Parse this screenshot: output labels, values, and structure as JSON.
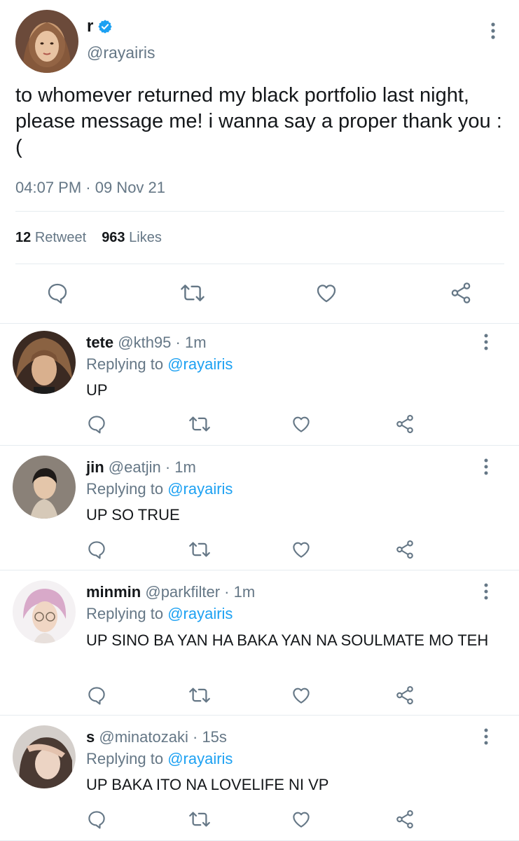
{
  "main_tweet": {
    "display_name": "r",
    "handle": "@rayairis",
    "text": "to whomever returned my black portfolio last night, please message me! i wanna say a proper thank you :(",
    "timestamp": "04:07 PM · 09 Nov 21",
    "retweet_count": "12",
    "retweet_label": "Retweet",
    "like_count": "963",
    "like_label": "Likes"
  },
  "colors": {
    "accent": "#1da1f2",
    "secondary_text": "#657786",
    "primary_text": "#14171a",
    "divider": "#e6ecf0"
  },
  "icons": [
    "reply-icon",
    "retweet-icon",
    "like-icon",
    "share-icon",
    "more-icon",
    "verified-icon"
  ],
  "reply_prefix": "Replying to",
  "replies": [
    {
      "name": "tete",
      "handle": "@kth95",
      "time": "1m",
      "replying_to": "@rayairis",
      "text": "UP"
    },
    {
      "name": "jin",
      "handle": "@eatjin",
      "time": "1m",
      "replying_to": "@rayairis",
      "text": "UP SO TRUE"
    },
    {
      "name": "minmin",
      "handle": "@parkfilter",
      "time": "1m",
      "replying_to": "@rayairis",
      "text": "UP SINO BA YAN HA BAKA YAN NA SOULMATE MO TEH"
    },
    {
      "name": "s",
      "handle": "@minatozaki",
      "time": "15s",
      "replying_to": "@rayairis",
      "text": "UP BAKA ITO NA LOVELIFE NI VP"
    }
  ]
}
